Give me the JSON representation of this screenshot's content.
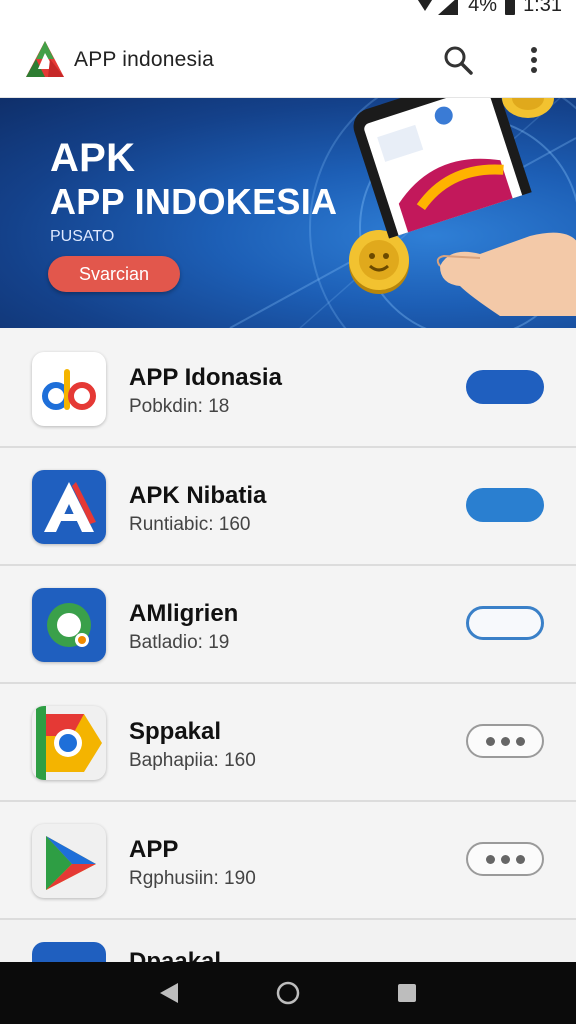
{
  "status_bar": {
    "battery_text": "4%",
    "time": "1:31"
  },
  "app_bar": {
    "title": "APP indonesia"
  },
  "banner": {
    "title_line1": "APK",
    "title_line2": "APP INDOKESIA",
    "subtitle": "PUSATO",
    "cta_label": "Svarcian"
  },
  "apps": [
    {
      "name": "APP Idonasia",
      "meta": "Pobkdin: 18",
      "action": "filled-dark"
    },
    {
      "name": "APK Nibatia",
      "meta": "Runtiabic: 160",
      "action": "filled"
    },
    {
      "name": "AMligrien",
      "meta": "Batladio: 19",
      "action": "outline"
    },
    {
      "name": "Sppakal",
      "meta": "Baphapiia: 160",
      "action": "more"
    },
    {
      "name": "APP",
      "meta": "Rgphusiin: 190",
      "action": "more"
    }
  ],
  "partial_app": {
    "name": "Dpaakal"
  },
  "colors": {
    "accent": "#1f5fbf",
    "cta": "#e2574c",
    "banner": "#1d5fb6"
  }
}
